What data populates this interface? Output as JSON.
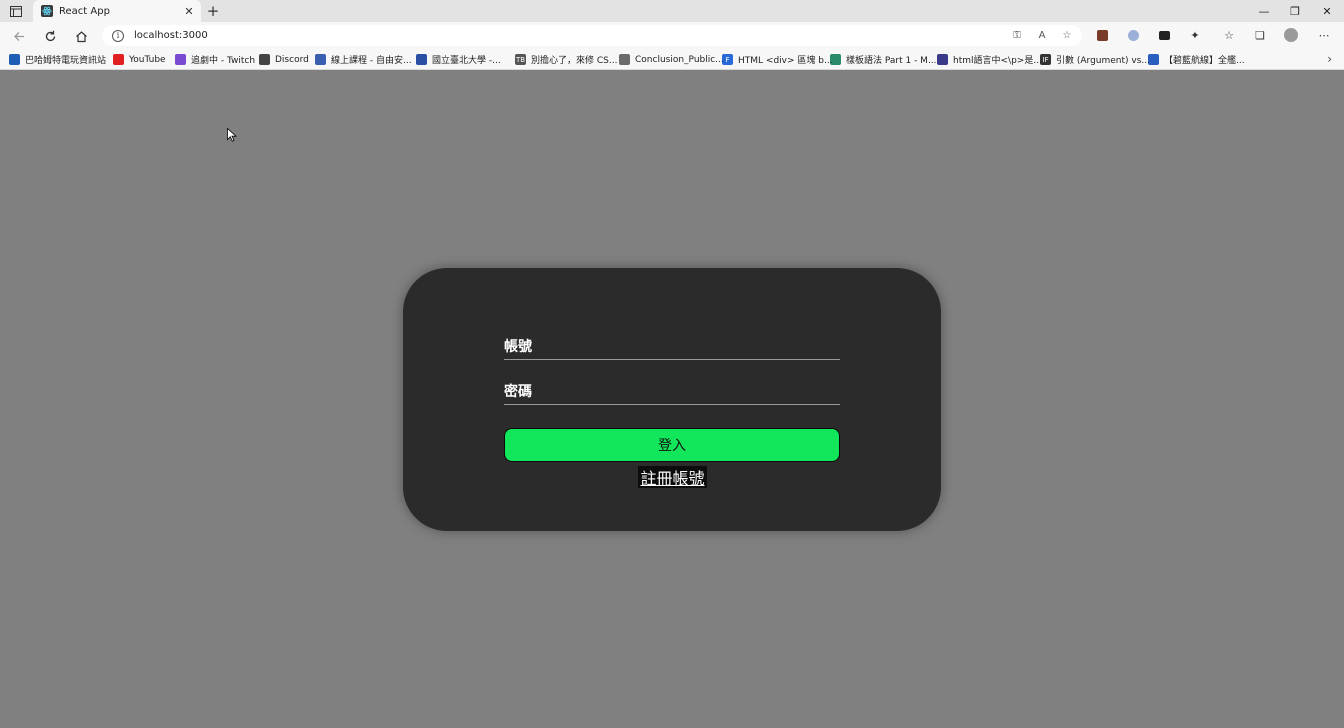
{
  "browser": {
    "tab_title": "React App",
    "url": "localhost:3000",
    "new_tab_label": "+",
    "close_tab_label": "✕",
    "window_controls": {
      "minimize": "—",
      "restore": "❐",
      "close": "✕"
    }
  },
  "bookmarks": [
    {
      "label": "巴哈姆特電玩資訊站",
      "icon": "bahamut-icon",
      "color": "#1e5fb5"
    },
    {
      "label": "YouTube",
      "icon": "youtube-icon",
      "color": "#e02020"
    },
    {
      "label": "追劇中 - Twitch",
      "icon": "twitch-icon",
      "color": "#7a4ad0"
    },
    {
      "label": "Discord",
      "icon": "discord-icon",
      "color": "#444444"
    },
    {
      "label": "線上課程 - 自由安...",
      "icon": "course-icon",
      "color": "#3a5fb0"
    },
    {
      "label": "國立臺北大學 -...",
      "icon": "ntpu-icon",
      "color": "#2b4fa3"
    },
    {
      "label": "別擔心了，來修 CS...",
      "icon": "tb-icon",
      "color": "#555555",
      "ic_text": "TB"
    },
    {
      "label": "Conclusion_Public...",
      "icon": "document-icon",
      "color": "#6b6b6b"
    },
    {
      "label": "HTML <div> 區塊 b...",
      "icon": "f-icon",
      "color": "#2a6ad8",
      "ic_text": "F"
    },
    {
      "label": "樣板語法 Part 1 - M...",
      "icon": "vue-icon",
      "color": "#2a8a6a"
    },
    {
      "label": "html語言中<\\p>是...",
      "icon": "link-icon",
      "color": "#3a3a8a"
    },
    {
      "label": "引數 (Argument) vs...",
      "icon": "if-icon",
      "color": "#333333",
      "ic_text": "IF"
    },
    {
      "label": "【碧藍航線】全艦...",
      "icon": "calendar-icon",
      "color": "#2a5fc0"
    }
  ],
  "login": {
    "account_placeholder": "帳號",
    "password_placeholder": "密碼",
    "login_label": "登入",
    "register_label": "註冊帳號"
  },
  "colors": {
    "page_bg": "#808080",
    "card_bg": "#2b2b2b",
    "login_button": "#12e65a"
  }
}
